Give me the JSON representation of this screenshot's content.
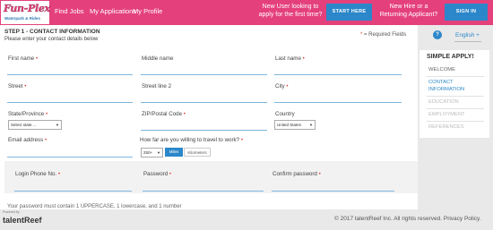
{
  "header": {
    "logo_line1": "Fun-Plex",
    "logo_line2": "Waterpark & Rides",
    "nav": [
      "Find Jobs",
      "My Applications",
      "My Profile"
    ],
    "promo_new_text_1": "New User looking to",
    "promo_new_text_2": "apply for the first time?",
    "start_label": "START HERE",
    "promo_return_text_1": "New Hire or a",
    "promo_return_text_2": "Returning Applicant?",
    "signin_label": "SIGN IN",
    "colors": {
      "brand": "#e4407c",
      "button": "#2b87c9"
    }
  },
  "form": {
    "step_title": "STEP 1 - CONTACT INFORMATION",
    "step_subtitle": "Please enter your contact details below",
    "required_star": "*",
    "required_text": "= Required Fields",
    "help_icon": "?",
    "language": "English",
    "language_plus": "+",
    "fields": {
      "first_name": "First name",
      "middle_name": "Middle name",
      "last_name": "Last name",
      "street": "Street",
      "street2": "Street line 2",
      "city": "City",
      "state": "State/Province",
      "zip": "ZIP/Postal Code",
      "country": "Country",
      "email": "Email address",
      "travel": "How far are you willing to travel to work?",
      "login_phone": "Login Phone No.",
      "password": "Password",
      "confirm_password": "Confirm password"
    },
    "state_value": "Select state ...",
    "country_value": "United States",
    "distance_value": "250+",
    "unit_miles": "Miles",
    "unit_km": "Kilometers",
    "password_note": "Your password must contain 1 UPPERCASE, 1 lowercase, and 1 number"
  },
  "sidebar": {
    "title": "SIMPLE APPLY!",
    "items": [
      "WELCOME",
      "CONTACT",
      "INFORMATION",
      "EDUCATION",
      "EMPLOYMENT",
      "REFERENCES"
    ]
  },
  "footer": {
    "powered": "Powered by",
    "brand": "talentReef",
    "copyright": "© 2017 talentReef Inc. All rights reserved. Privacy Policy."
  }
}
